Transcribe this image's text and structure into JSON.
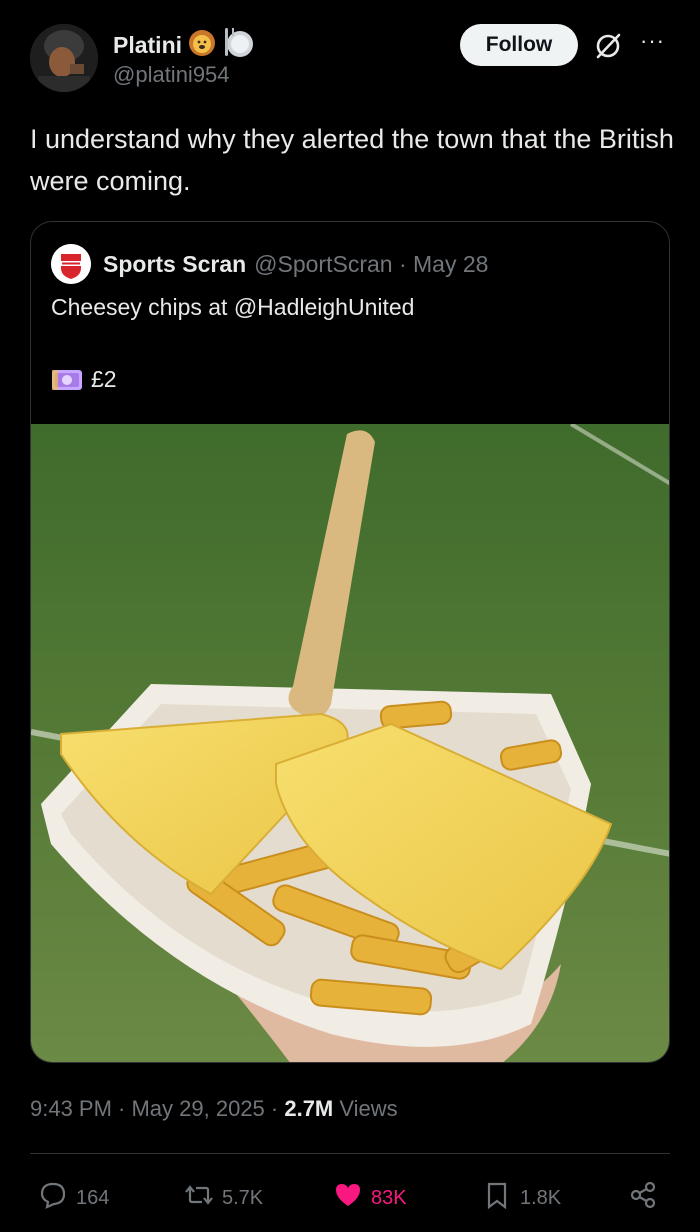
{
  "author": {
    "display_name": "Platini",
    "emojis": [
      "lion-emoji",
      "plate-emoji"
    ],
    "handle": "@platini954"
  },
  "header": {
    "follow_label": "Follow",
    "more_label": "···"
  },
  "tweet": {
    "text": "I understand why they alerted the town that the British were coming."
  },
  "quote": {
    "display_name": "Sports Scran",
    "handle_date": "@SportScran · May 28",
    "text_line1": "Cheesey chips at @HadleighUnited",
    "price_text": "£2",
    "image_alt": "Cheesy chips in a paper tray held over a football pitch"
  },
  "meta": {
    "time_date": "9:43 PM · May 29, 2025 · ",
    "views_count": "2.7M",
    "views_label": " Views"
  },
  "actions": {
    "replies": "164",
    "reposts": "5.7K",
    "likes": "83K",
    "bookmarks": "1.8K"
  },
  "colors": {
    "background": "#000000",
    "text": "#e7e9ea",
    "muted": "#71767b",
    "like": "#f91880",
    "border": "#2f3336"
  }
}
